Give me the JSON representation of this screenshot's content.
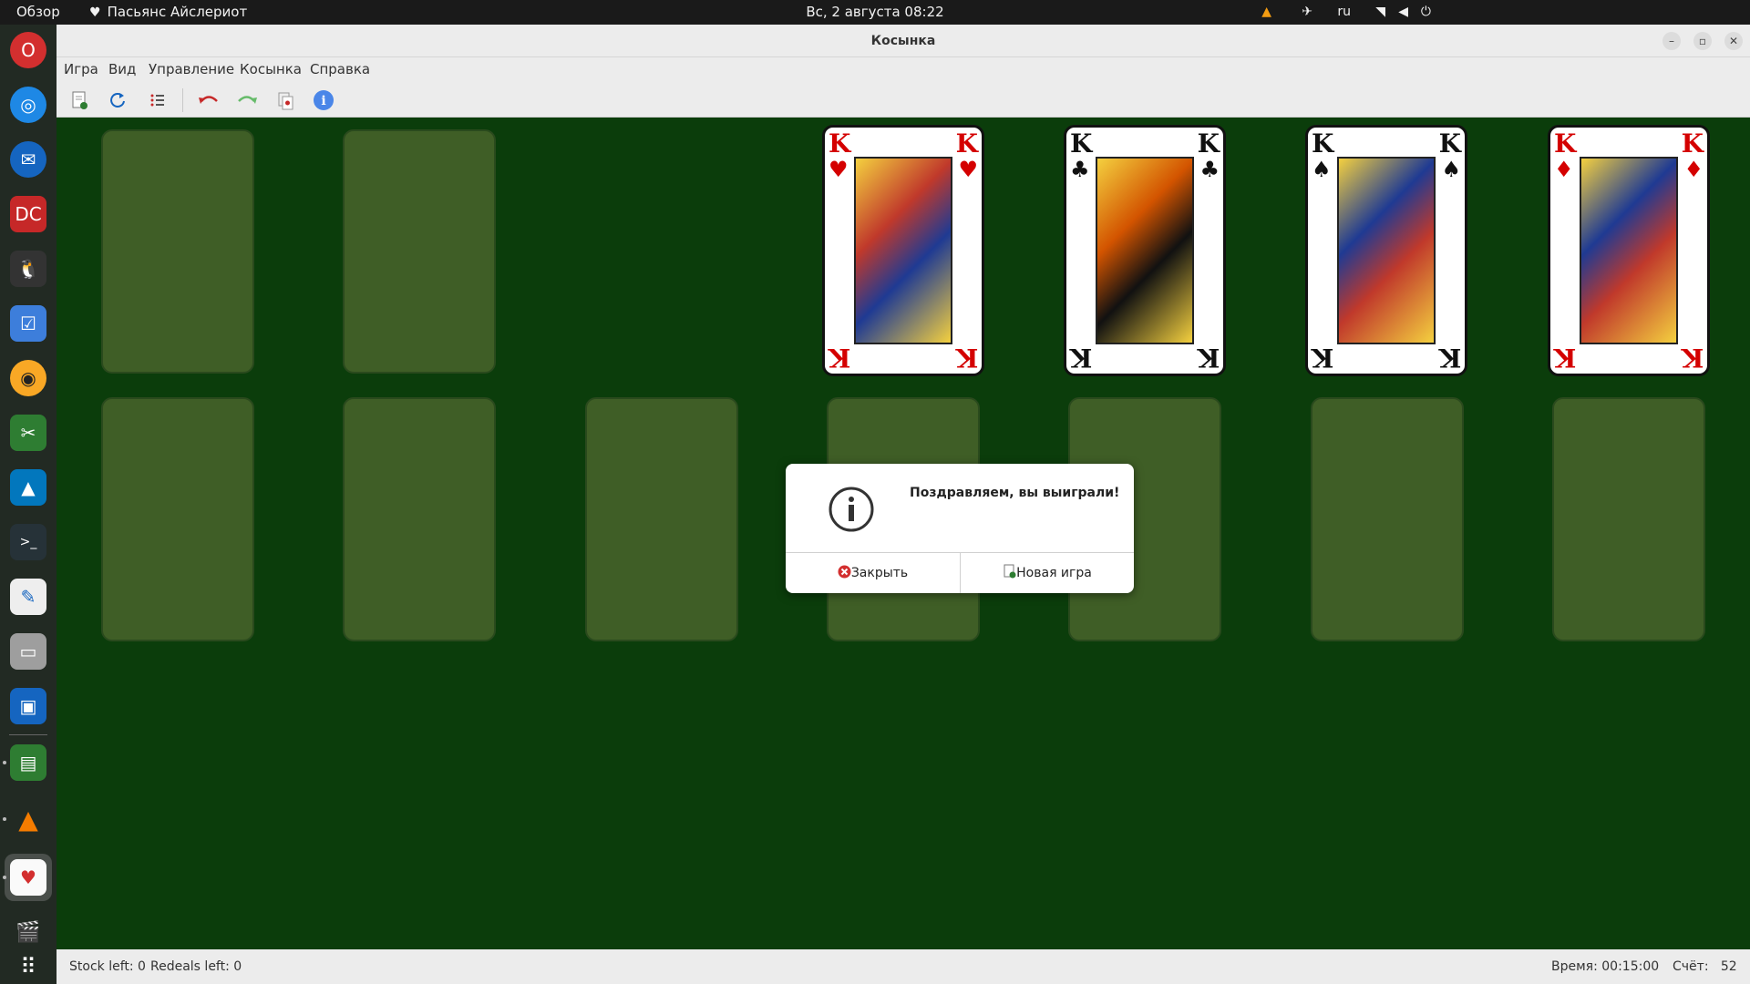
{
  "topbar": {
    "overview": "Обзор",
    "app_name": "Пасьянс Айслериот",
    "clock": "Вс, 2 августа  08:22",
    "lang": "ru"
  },
  "window": {
    "title": "Косынка"
  },
  "menu": {
    "items": [
      "Игра",
      "Вид",
      "Управление",
      "Косынка",
      "Справка"
    ]
  },
  "foundation": {
    "cards": [
      {
        "rank": "K",
        "suit": "♥",
        "color": "#d40000"
      },
      {
        "rank": "K",
        "suit": "♣",
        "color": "#111111"
      },
      {
        "rank": "K",
        "suit": "♠",
        "color": "#111111"
      },
      {
        "rank": "K",
        "suit": "♦",
        "color": "#d40000"
      }
    ]
  },
  "dialog": {
    "message": "Поздравляем, вы выиграли!",
    "close_label": "Закрыть",
    "new_game_label": "Новая игра"
  },
  "statusbar": {
    "stock": "Stock left: 0",
    "redeals": "Redeals left: 0",
    "time": "Время: 00:15:00",
    "score": "Счёт:   52"
  },
  "colors": {
    "felt": "#0b3d0b",
    "slot": "#3f5e26",
    "undo": "#c62828",
    "redo": "#4caf50",
    "info": "#3d7edb"
  }
}
